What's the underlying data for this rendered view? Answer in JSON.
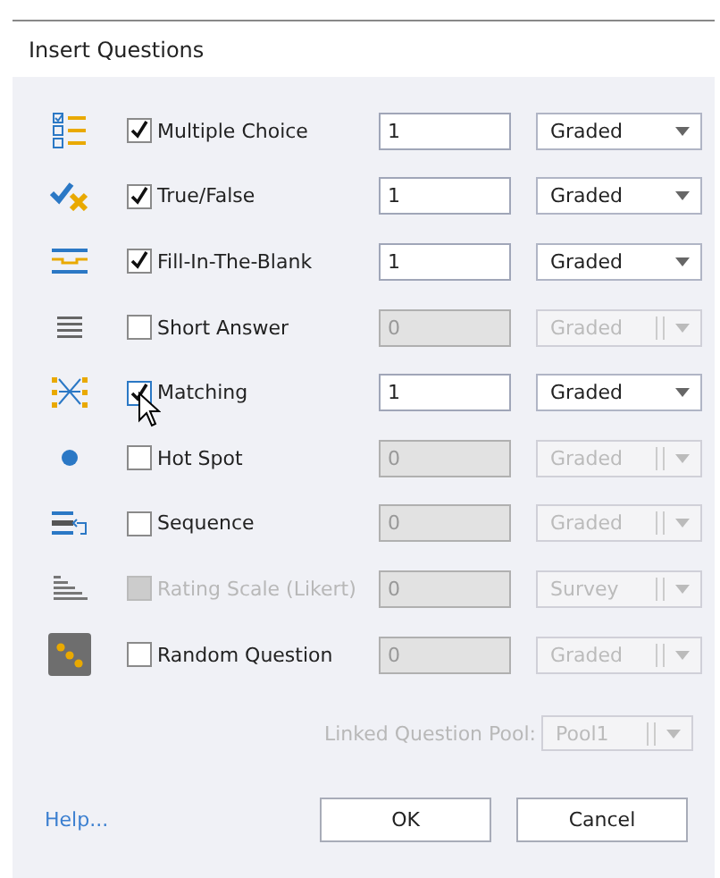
{
  "window": {
    "title": "Insert Questions"
  },
  "questions": [
    {
      "kind": "multiple_choice",
      "label": "Multiple Choice",
      "checked": true,
      "disabled": false,
      "focused": false,
      "count": "1",
      "grading": "Graded"
    },
    {
      "kind": "true_false",
      "label": "True/False",
      "checked": true,
      "disabled": false,
      "focused": false,
      "count": "1",
      "grading": "Graded"
    },
    {
      "kind": "fill_blank",
      "label": "Fill-In-The-Blank",
      "checked": true,
      "disabled": false,
      "focused": false,
      "count": "1",
      "grading": "Graded"
    },
    {
      "kind": "short_answer",
      "label": "Short Answer",
      "checked": false,
      "disabled": false,
      "focused": false,
      "count": "0",
      "grading": "Graded"
    },
    {
      "kind": "matching",
      "label": "Matching",
      "checked": true,
      "disabled": false,
      "focused": true,
      "count": "1",
      "grading": "Graded"
    },
    {
      "kind": "hot_spot",
      "label": "Hot Spot",
      "checked": false,
      "disabled": false,
      "focused": false,
      "count": "0",
      "grading": "Graded"
    },
    {
      "kind": "sequence",
      "label": "Sequence",
      "checked": false,
      "disabled": false,
      "focused": false,
      "count": "0",
      "grading": "Graded"
    },
    {
      "kind": "rating_scale",
      "label": "Rating Scale (Likert)",
      "checked": false,
      "disabled": true,
      "focused": false,
      "count": "0",
      "grading": "Survey"
    },
    {
      "kind": "random",
      "label": "Random Question",
      "checked": false,
      "disabled": false,
      "focused": false,
      "count": "0",
      "grading": "Graded"
    }
  ],
  "pool": {
    "label": "Linked Question Pool:",
    "value": "Pool1",
    "disabled": true
  },
  "help_link": "Help...",
  "buttons": [
    "OK",
    "Cancel"
  ]
}
